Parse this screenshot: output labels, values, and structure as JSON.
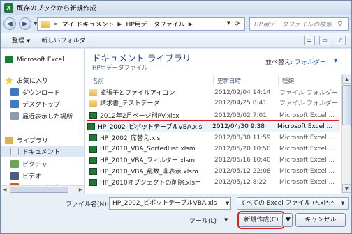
{
  "window": {
    "title": "既存のブックから新規作成",
    "app_icon": "X"
  },
  "address": {
    "prefix": "«",
    "crumbs": [
      "マイ ドキュメント",
      "HP用データファイル"
    ],
    "search_placeholder": "HP用データファイルの検索"
  },
  "toolbar": {
    "organize": "整理",
    "new_folder": "新しいフォルダー"
  },
  "nav": {
    "items": [
      {
        "label": "Microsoft Excel"
      },
      {
        "label": "お気に入り"
      },
      {
        "label": "ダウンロード"
      },
      {
        "label": "デスクトップ"
      },
      {
        "label": "最近表示した場所"
      },
      {
        "label": "ライブラリ"
      },
      {
        "label": "ドキュメント"
      },
      {
        "label": "ピクチャ"
      },
      {
        "label": "ビデオ"
      },
      {
        "label": "ミュージック"
      }
    ]
  },
  "library": {
    "title": "ドキュメント ライブラリ",
    "subtitle": "HP用データファイル",
    "arrange_label": "並べ替え:",
    "arrange_value": "フォルダー"
  },
  "columns": {
    "name": "名前",
    "date": "更新日時",
    "type": "種類"
  },
  "files": [
    {
      "name": "拡張子とファイルアイコン",
      "date": "2012/02/04 14:14",
      "type": "ファイル フォルダー"
    },
    {
      "name": "請求書_テストデータ",
      "date": "2012/04/25 8:41",
      "type": "ファイル フォルダー"
    },
    {
      "name": "2012年2月ページ別PV.xlsx",
      "date": "2012/03/02 7:01",
      "type": "Microsoft Excel ..."
    },
    {
      "name": "HP_2002_ピボットテーブルVBA.xls",
      "date": "2012/04/30 9:38",
      "type": "Microsoft Excel ..."
    },
    {
      "name": "HP_2002_席替え.xls",
      "date": "2012/03/30 11:59",
      "type": "Microsoft Excel ..."
    },
    {
      "name": "HP_2010_VBA_SortedList.xlsm",
      "date": "2012/05/20 10:50",
      "type": "Microsoft Excel ..."
    },
    {
      "name": "HP_2010_VBA_フィルター.xlsm",
      "date": "2012/05/16 10:40",
      "type": "Microsoft Excel ..."
    },
    {
      "name": "HP_2010_VBA_乱数_非表示.xlsm",
      "date": "2012/05/12 22:08",
      "type": "Microsoft Excel ..."
    },
    {
      "name": "HP_2010オブジェクトの削除.xlsm",
      "date": "2012/05/12 8:22",
      "type": "Microsoft Excel ..."
    }
  ],
  "bottom": {
    "filename_label": "ファイル名(N):",
    "filename_value": "HP_2002_ピボットテーブルVBA.xls",
    "filter_value": "すべての Excel ファイル (*.xl*;*.",
    "tools": "ツール(L)",
    "new_button": "新規作成(C)",
    "cancel_button": "キャンセル"
  }
}
